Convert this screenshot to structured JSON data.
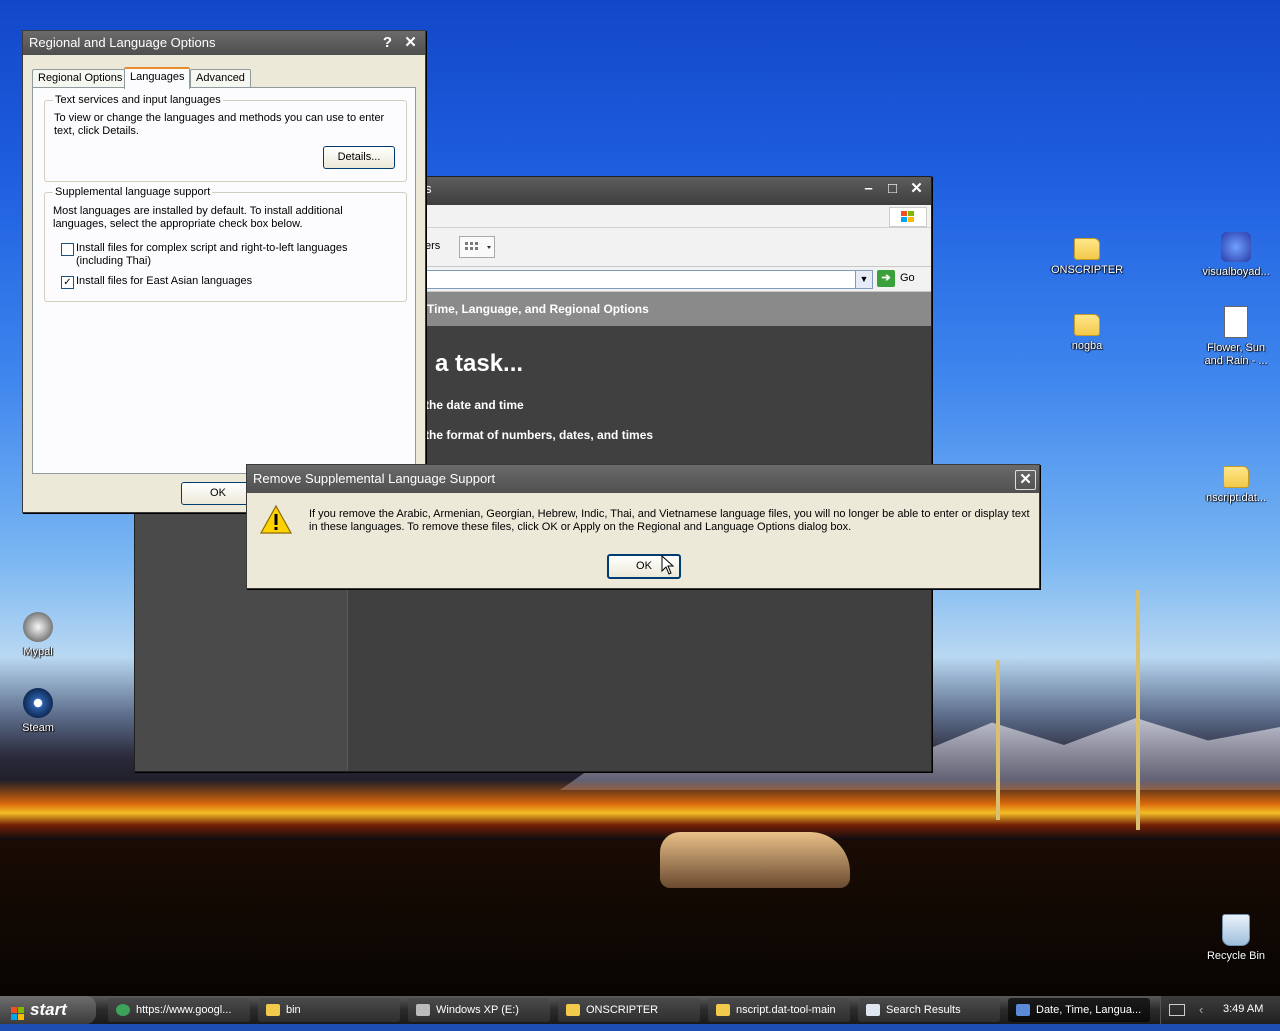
{
  "desktop": {
    "icons_left": [
      {
        "label": "Mypal",
        "icon": "mypal-icon"
      },
      {
        "label": "Steam",
        "icon": "steam-icon"
      }
    ],
    "icons_right": [
      {
        "label": "ONSCRIPTER",
        "icon": "folder-icon"
      },
      {
        "label": "visualboyad...",
        "icon": "visualboyadvance-icon"
      },
      {
        "label": "nogba",
        "icon": "folder-icon"
      },
      {
        "label": "Flower, Sun and Rain - ...",
        "icon": "document-icon"
      },
      {
        "label": "nscript.dat...",
        "icon": "folder-icon"
      },
      {
        "label": "Recycle Bin",
        "icon": "recycle-bin-icon"
      }
    ]
  },
  "explorer": {
    "title_fragment": "s",
    "toolbar_fragment": "ers",
    "go_label": "Go",
    "header": "Time, Language, and Regional Options",
    "pick_task": "a task...",
    "tasks": [
      "the date and time",
      "the format of numbers, dates, and times"
    ]
  },
  "regional": {
    "title": "Regional and Language Options",
    "tabs": [
      "Regional Options",
      "Languages",
      "Advanced"
    ],
    "text_services": {
      "legend": "Text services and input languages",
      "description": "To view or change the languages and methods you can use to enter text, click Details.",
      "details_button": "Details..."
    },
    "supplemental": {
      "legend": "Supplemental language support",
      "description": "Most languages are installed by default. To install additional languages, select the appropriate check box below.",
      "complex_script_label": "Install files for complex script and right-to-left languages (including Thai)",
      "complex_script_checked": false,
      "east_asian_label": "Install files for East Asian languages",
      "east_asian_checked": true
    },
    "ok_button": "OK"
  },
  "alert": {
    "title": "Remove Supplemental Language Support",
    "message": "If you remove the Arabic, Armenian, Georgian, Hebrew, Indic, Thai, and Vietnamese language files, you will no longer be able to enter or display text in these languages. To remove these files, click OK or Apply on the Regional and Language Options dialog box.",
    "ok_button": "OK"
  },
  "taskbar": {
    "start_label": "start",
    "tasks": [
      {
        "label": "https://www.googl...",
        "icon": "browser-icon",
        "active": false
      },
      {
        "label": "bin",
        "icon": "folder-icon",
        "active": false
      },
      {
        "label": "Windows XP (E:)",
        "icon": "drive-icon",
        "active": false
      },
      {
        "label": "ONSCRIPTER",
        "icon": "folder-icon",
        "active": false
      },
      {
        "label": "nscript.dat-tool-main",
        "icon": "folder-icon",
        "active": false
      },
      {
        "label": "Search Results",
        "icon": "search-results-icon",
        "active": false
      },
      {
        "label": "Date, Time, Langua...",
        "icon": "control-panel-icon",
        "active": true
      }
    ],
    "clock": "3:49 AM"
  },
  "colors": {
    "accent": "#e68b2c",
    "title_bar": "#505050",
    "dialog_face": "#ece9d8"
  }
}
